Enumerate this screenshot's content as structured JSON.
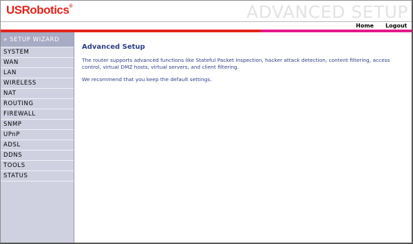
{
  "brand": {
    "name": "USRobotics",
    "trademark": "®",
    "color": "#e2231a"
  },
  "header": {
    "section_title": "ADVANCED SETUP"
  },
  "topnav": {
    "home": "Home",
    "logout": "Logout"
  },
  "colors": {
    "accent_red": "#e2231a",
    "accent_pink": "#e4188a",
    "text_blue": "#2b3e86",
    "sidebar_bg": "#cfd0e0"
  },
  "sidebar": {
    "wizard_label": "» SETUP WIZARD",
    "items": [
      {
        "label": "SYSTEM"
      },
      {
        "label": "WAN"
      },
      {
        "label": "LAN"
      },
      {
        "label": "WIRELESS"
      },
      {
        "label": "NAT"
      },
      {
        "label": "ROUTING"
      },
      {
        "label": "FIREWALL"
      },
      {
        "label": "SNMP"
      },
      {
        "label": "UPnP"
      },
      {
        "label": "ADSL"
      },
      {
        "label": "DDNS"
      },
      {
        "label": "TOOLS"
      },
      {
        "label": "STATUS"
      }
    ]
  },
  "main": {
    "title": "Advanced Setup",
    "paragraphs": [
      "The router supports advanced functions like Stateful Packet Inspection, hacker attack detection, content filtering, access control, virtual DMZ hosts, virtual servers, and client filtering.",
      "We recommend that you keep the default settings."
    ]
  }
}
